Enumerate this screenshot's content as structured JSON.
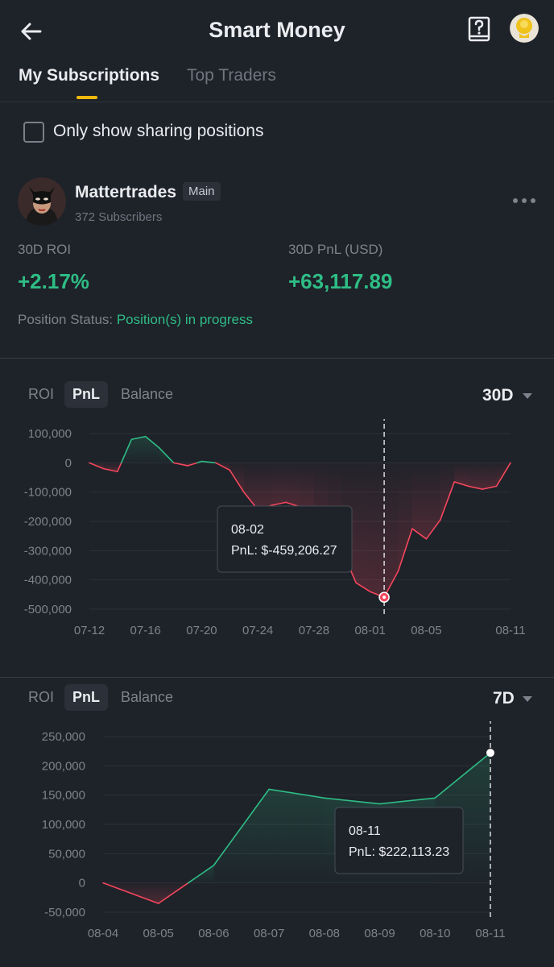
{
  "header": {
    "title": "Smart Money"
  },
  "tabs": [
    {
      "label": "My Subscriptions",
      "active": true
    },
    {
      "label": "Top Traders",
      "active": false
    }
  ],
  "filter": {
    "label": "Only show sharing positions",
    "checked": false
  },
  "trader": {
    "name": "Mattertrades",
    "badge": "Main",
    "subscribers": "372 Subscribers",
    "roi_label": "30D ROI",
    "roi_value": "+2.17%",
    "pnl_label": "30D PnL (USD)",
    "pnl_value": "+63,117.89",
    "status_label": "Position Status: ",
    "status_value": "Position(s) in progress"
  },
  "colors": {
    "positive": "#2ebd85",
    "negative": "#f6465d",
    "accent": "#f0b90b",
    "background": "#1e2229"
  },
  "charts": [
    {
      "tabs": [
        "ROI",
        "PnL",
        "Balance"
      ],
      "active_tab": "PnL",
      "range": "30D",
      "tooltip": {
        "date": "08-02",
        "text": "PnL: $-459,206.27"
      }
    },
    {
      "tabs": [
        "ROI",
        "PnL",
        "Balance"
      ],
      "active_tab": "PnL",
      "range": "7D",
      "tooltip": {
        "date": "08-11",
        "text": "PnL: $222,113.23"
      }
    }
  ],
  "chart_data": [
    {
      "type": "line",
      "ylim": [
        -500000,
        100000
      ],
      "y_ticks": [
        100000,
        0,
        -100000,
        -200000,
        -300000,
        -400000,
        -500000
      ],
      "y_tick_labels": [
        "100,000",
        "0",
        "-100,000",
        "-200,000",
        "-300,000",
        "-400,000",
        "-500,000"
      ],
      "x_tick_labels": [
        "07-12",
        "07-16",
        "07-20",
        "07-24",
        "07-28",
        "08-01",
        "08-05",
        "08-11"
      ],
      "x_tick_days": [
        0,
        4,
        8,
        12,
        16,
        20,
        24,
        30
      ],
      "x_range_days": [
        0,
        30
      ],
      "points": [
        [
          0,
          0
        ],
        [
          1,
          -20000
        ],
        [
          2,
          -30000
        ],
        [
          3,
          80000
        ],
        [
          4,
          90000
        ],
        [
          5,
          50000
        ],
        [
          6,
          0
        ],
        [
          7,
          -10000
        ],
        [
          8,
          5000
        ],
        [
          9,
          0
        ],
        [
          10,
          -25000
        ],
        [
          11,
          -100000
        ],
        [
          12,
          -160000
        ],
        [
          13,
          -145000
        ],
        [
          14,
          -135000
        ],
        [
          15,
          -150000
        ],
        [
          16,
          -165000
        ],
        [
          17,
          -230000
        ],
        [
          18,
          -300000
        ],
        [
          19,
          -410000
        ],
        [
          20,
          -440000
        ],
        [
          21,
          -459206.27
        ],
        [
          22,
          -370000
        ],
        [
          23,
          -225000
        ],
        [
          24,
          -260000
        ],
        [
          25,
          -195000
        ],
        [
          26,
          -65000
        ],
        [
          27,
          -80000
        ],
        [
          28,
          -90000
        ],
        [
          29,
          -80000
        ],
        [
          30,
          0
        ]
      ],
      "highlight_index": 21,
      "grid": true
    },
    {
      "type": "line",
      "ylim": [
        -50000,
        250000
      ],
      "y_ticks": [
        250000,
        200000,
        150000,
        100000,
        50000,
        0,
        -50000
      ],
      "y_tick_labels": [
        "250,000",
        "200,000",
        "150,000",
        "100,000",
        "50,000",
        "0",
        "-50,000"
      ],
      "x": [
        "08-04",
        "08-05",
        "08-06",
        "08-07",
        "08-08",
        "08-09",
        "08-10",
        "08-11"
      ],
      "values": [
        0,
        -35000,
        30000,
        160000,
        145000,
        135000,
        145000,
        222113.23
      ],
      "highlight_index": 7,
      "grid": true
    }
  ]
}
